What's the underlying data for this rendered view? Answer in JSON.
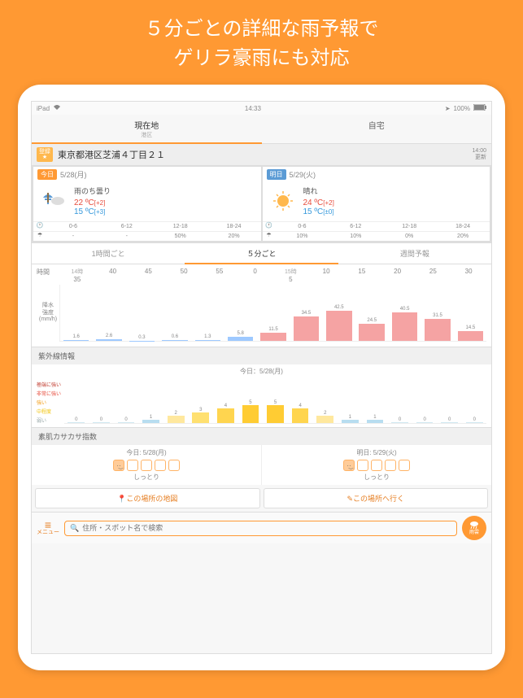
{
  "promo": {
    "line1": "５分ごとの詳細な雨予報で",
    "line2": "ゲリラ豪雨にも対応"
  },
  "status": {
    "device": "iPad",
    "time": "14:33",
    "battery": "100%"
  },
  "tabs": {
    "current": "現在地",
    "current_sub": "港区",
    "home": "自宅"
  },
  "address": "東京都港区芝浦４丁目２１",
  "update": {
    "time": "14:00",
    "label": "更新"
  },
  "star_label": "登録",
  "today": {
    "label": "今日",
    "date": "5/28(月)",
    "cond": "雨のち曇り",
    "hi": "22",
    "hi_diff": "[+2]",
    "lo": "15",
    "lo_diff": "[+3]",
    "slots": [
      "0-6",
      "6-12",
      "12-18",
      "18-24"
    ],
    "pops": [
      "-",
      "-",
      "50%",
      "20%"
    ]
  },
  "tomorrow": {
    "label": "明日",
    "date": "5/29(火)",
    "cond": "晴れ",
    "hi": "24",
    "hi_diff": "[+2]",
    "lo": "15",
    "lo_diff": "[±0]",
    "slots": [
      "0-6",
      "6-12",
      "12-18",
      "18-24"
    ],
    "pops": [
      "10%",
      "10%",
      "0%",
      "20%"
    ]
  },
  "interval_tabs": {
    "hourly": "1時間ごと",
    "five": "５分ごと",
    "weekly": "週間予報"
  },
  "chart_data": {
    "type": "bar",
    "title": "降水強度 (mm/h)",
    "xlabel": "時間",
    "ylabel": "降水強度(mm/h)",
    "hour_marks": [
      "14時",
      "15時"
    ],
    "categories": [
      "35",
      "40",
      "45",
      "50",
      "55",
      "0",
      "5",
      "10",
      "15",
      "20",
      "25",
      "30"
    ],
    "values": [
      1.6,
      2.6,
      0.3,
      0.6,
      1.3,
      5.8,
      11.5,
      34.5,
      42.5,
      24.5,
      40.5,
      31.5,
      14.5
    ],
    "colors": [
      "blue",
      "blue",
      "blue",
      "blue",
      "blue",
      "blue",
      "pink",
      "pink",
      "pink",
      "pink",
      "pink",
      "pink",
      "pink"
    ],
    "ylim": [
      0,
      80
    ]
  },
  "uv": {
    "title": "紫外線情報",
    "date": "今日：5/28(月)",
    "legend": [
      "極端に強い",
      "非常に強い",
      "強い",
      "中程度",
      "弱い"
    ],
    "values": [
      0,
      0,
      0,
      1,
      2,
      3,
      4,
      5,
      5,
      4,
      2,
      1,
      1,
      0,
      0,
      0,
      0
    ]
  },
  "skin": {
    "title": "素肌カサカサ指数",
    "today": {
      "date": "今日: 5/28(月)",
      "level": 1,
      "label": "しっとり"
    },
    "tomorrow": {
      "date": "明日: 5/29(火)",
      "level": 1,
      "label": "しっとり"
    }
  },
  "actions": {
    "map": "この場所の地図",
    "go": "この場所へ行く"
  },
  "bottom": {
    "menu": "メニュー",
    "search_placeholder": "住所・スポット名で検索",
    "rain": "雨雲"
  }
}
